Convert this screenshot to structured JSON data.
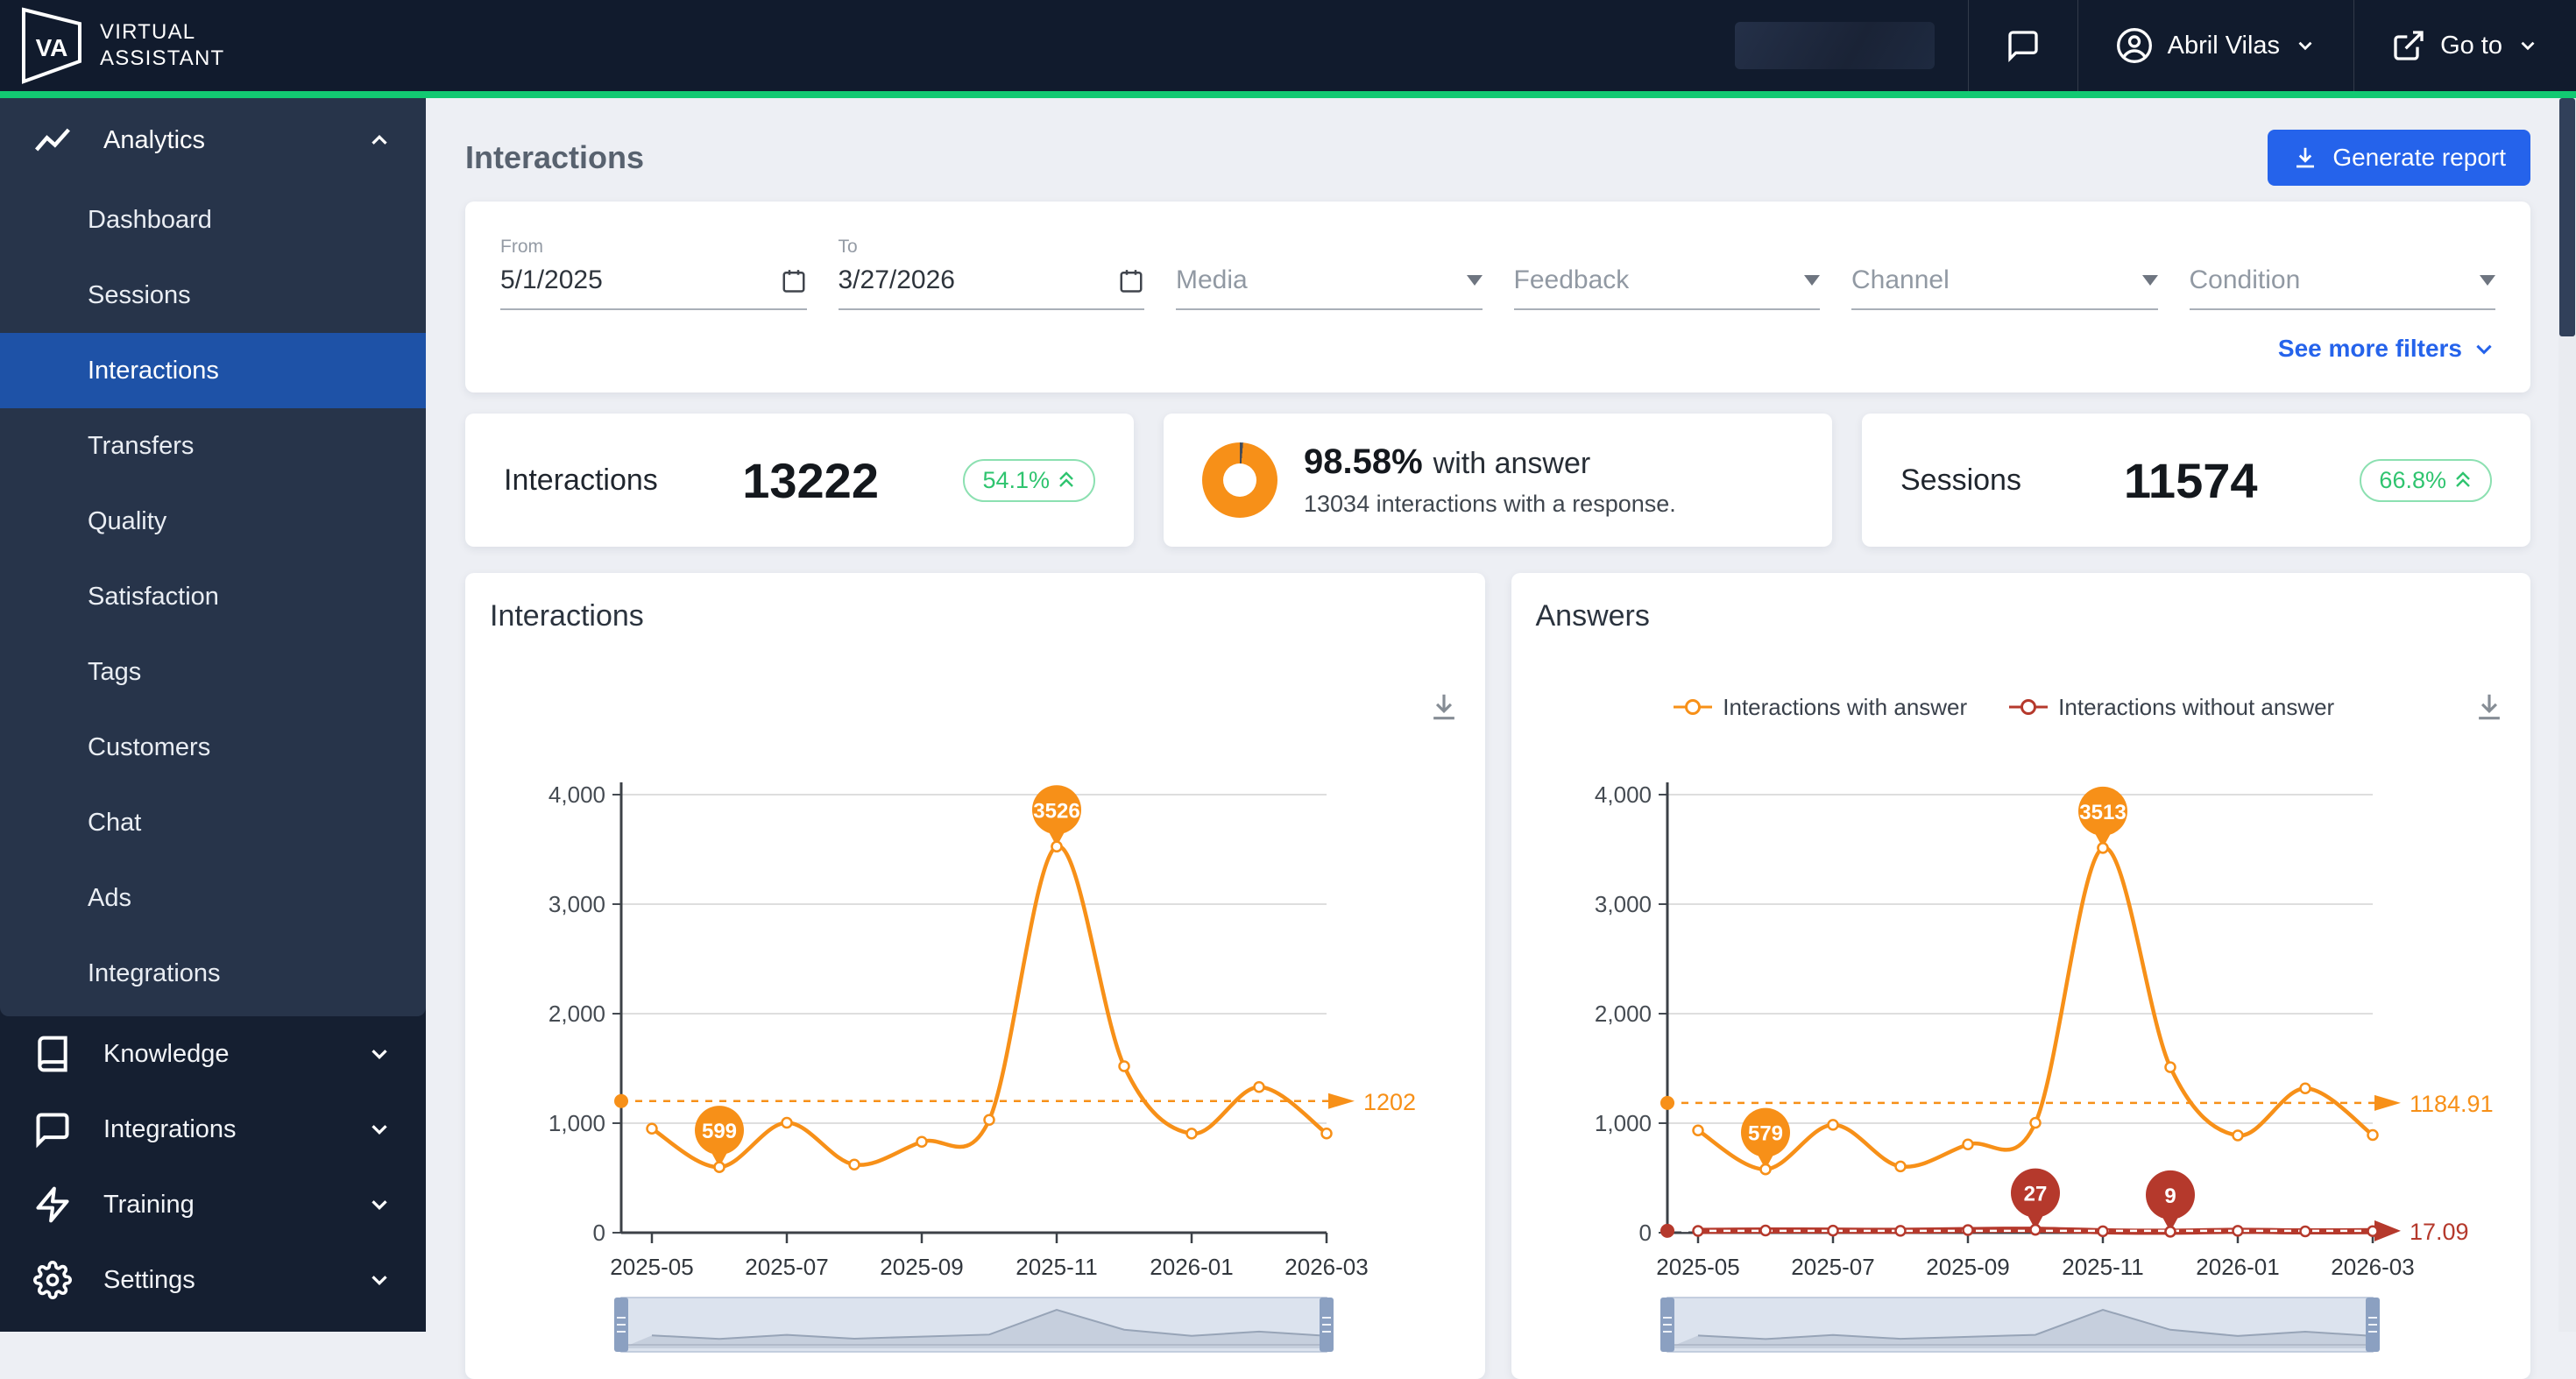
{
  "colors": {
    "accent_green": "#12c972",
    "primary_blue": "#2563eb",
    "series_orange": "#f79018",
    "series_red": "#b5392c",
    "badge_green": "#2fc46f",
    "sidebar_selected_blue": "#1e52a7"
  },
  "topbar": {
    "logo_text": "VA",
    "brand_line1": "VIRTUAL",
    "brand_line2": "ASSISTANT",
    "user_name": "Abril Vilas",
    "goto_label": "Go to"
  },
  "sidebar": {
    "analytics_group": {
      "label": "Analytics",
      "icon": "trending-up-icon",
      "items": [
        "Dashboard",
        "Sessions",
        "Interactions",
        "Transfers",
        "Quality",
        "Satisfaction",
        "Tags",
        "Customers",
        "Chat",
        "Ads",
        "Integrations"
      ],
      "selected_item": "Interactions"
    },
    "groups": [
      {
        "label": "Knowledge",
        "icon": "book-icon"
      },
      {
        "label": "Integrations",
        "icon": "chat-bubble-icon"
      },
      {
        "label": "Training",
        "icon": "lightning-icon"
      },
      {
        "label": "Settings",
        "icon": "gear-icon"
      }
    ]
  },
  "page": {
    "title": "Interactions",
    "generate_report_label": "Generate report"
  },
  "filters": {
    "from": {
      "label": "From",
      "value": "5/1/2025"
    },
    "to": {
      "label": "To",
      "value": "3/27/2026"
    },
    "dropdowns": [
      "Media",
      "Feedback",
      "Channel",
      "Condition"
    ],
    "see_more_label": "See more filters"
  },
  "stats": {
    "interactions": {
      "label": "Interactions",
      "value": "13222",
      "badge": "54.1%"
    },
    "with_answer": {
      "percent": "98.58%",
      "title_suffix": "with answer",
      "subtitle": "13034 interactions with a response.",
      "donut_percent": 98.58
    },
    "sessions": {
      "label": "Sessions",
      "value": "11574",
      "badge": "66.8%"
    }
  },
  "chart_data": [
    {
      "type": "line",
      "title": "Interactions",
      "x": [
        "2025-05",
        "2025-06",
        "2025-07",
        "2025-08",
        "2025-09",
        "2025-10",
        "2025-11",
        "2025-12",
        "2026-01",
        "2026-02",
        "2026-03"
      ],
      "xtick_labels": [
        "2025-05",
        "2025-07",
        "2025-09",
        "2025-11",
        "2026-01",
        "2026-03"
      ],
      "ylim": [
        0,
        4000
      ],
      "ytick_labels": [
        "0",
        "1,000",
        "2,000",
        "3,000",
        "4,000"
      ],
      "grid": true,
      "legend_position": "none",
      "series": [
        {
          "name": "Interactions",
          "color": "#f79018",
          "values": [
            950,
            599,
            1004,
            622,
            830,
            1030,
            3526,
            1520,
            905,
            1330,
            906
          ],
          "average": 1202,
          "average_label": "1202",
          "max_label": "3526",
          "max_index": 6,
          "min_label": "599",
          "min_index": 1
        }
      ]
    },
    {
      "type": "line",
      "title": "Answers",
      "x": [
        "2025-05",
        "2025-06",
        "2025-07",
        "2025-08",
        "2025-09",
        "2025-10",
        "2025-11",
        "2025-12",
        "2026-01",
        "2026-02",
        "2026-03"
      ],
      "xtick_labels": [
        "2025-05",
        "2025-07",
        "2025-09",
        "2025-11",
        "2026-01",
        "2026-03"
      ],
      "ylim": [
        0,
        4000
      ],
      "ytick_labels": [
        "0",
        "1,000",
        "2,000",
        "3,000",
        "4,000"
      ],
      "grid": true,
      "legend_position": "top",
      "series": [
        {
          "name": "Interactions with answer",
          "color": "#f79018",
          "values": [
            934,
            579,
            985,
            605,
            806,
            1003,
            3513,
            1511,
            888,
            1318,
            892
          ],
          "average": 1184.91,
          "average_label": "1184.91",
          "max_label": "3513",
          "max_index": 6,
          "min_label": "579",
          "min_index": 1
        },
        {
          "name": "Interactions without answer",
          "color": "#b5392c",
          "values": [
            16,
            20,
            19,
            17,
            24,
            27,
            13,
            9,
            17,
            12,
            14
          ],
          "average": 17.09,
          "average_label": "17.09",
          "max_label": "27",
          "max_index": 5,
          "min_label": "9",
          "min_index": 7
        }
      ]
    }
  ]
}
